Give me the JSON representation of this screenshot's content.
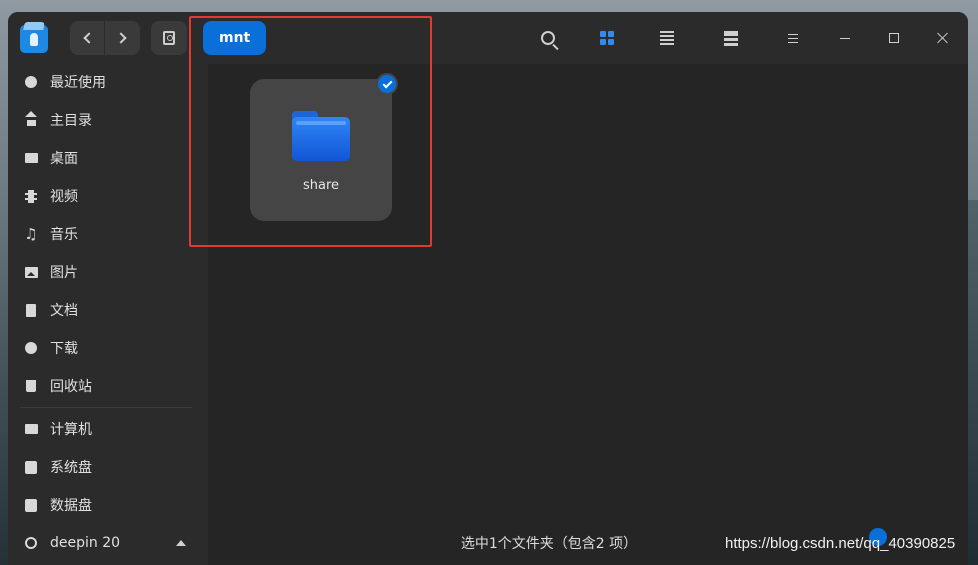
{
  "titlebar": {
    "breadcrumb": "mnt",
    "back_icon": "chevron-left-icon",
    "forward_icon": "chevron-right-icon",
    "disk_icon": "disk-icon",
    "search_icon": "search-icon",
    "icon_view_icon": "grid-view-icon",
    "list_view_icon": "list-view-icon",
    "detail_view_icon": "detail-view-icon",
    "menu_icon": "menu-icon",
    "minimize_icon": "minimize-icon",
    "maximize_icon": "maximize-icon",
    "close_icon": "close-icon"
  },
  "sidebar": {
    "items": [
      {
        "label": "最近使用",
        "icon": "clock-icon"
      },
      {
        "label": "主目录",
        "icon": "home-icon"
      },
      {
        "label": "桌面",
        "icon": "desktop-icon"
      },
      {
        "label": "视频",
        "icon": "video-icon"
      },
      {
        "label": "音乐",
        "icon": "music-icon"
      },
      {
        "label": "图片",
        "icon": "picture-icon"
      },
      {
        "label": "文档",
        "icon": "document-icon"
      },
      {
        "label": "下载",
        "icon": "download-icon"
      },
      {
        "label": "回收站",
        "icon": "trash-icon"
      }
    ],
    "devices": [
      {
        "label": "计算机",
        "icon": "computer-icon"
      },
      {
        "label": "系统盘",
        "icon": "system-disk-icon"
      },
      {
        "label": "数据盘",
        "icon": "data-disk-icon"
      },
      {
        "label": "deepin 20",
        "icon": "deepin-disk-icon"
      }
    ]
  },
  "main": {
    "files": [
      {
        "name": "share",
        "icon": "folder-icon",
        "selected": true
      }
    ],
    "status": "选中1个文件夹（包含2 项）"
  },
  "watermark": "https://blog.csdn.net/qq_40390825",
  "colors": {
    "accent": "#0a6fd8",
    "highlight_box": "#e23a2e",
    "window_bg": "#252525",
    "sidebar_bg": "#2b2b2b"
  }
}
